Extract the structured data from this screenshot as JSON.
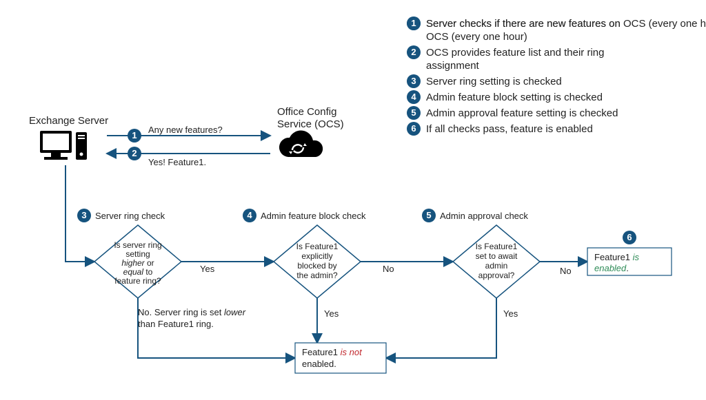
{
  "nodes": {
    "exchange": {
      "label": "Exchange Server"
    },
    "ocs": {
      "label1": "Office Config",
      "label2": "Service (OCS)"
    }
  },
  "topArrows": {
    "q": {
      "num": "1",
      "text": "Any new features?"
    },
    "a": {
      "num": "2",
      "text": "Yes! Feature1."
    }
  },
  "checks": {
    "d3": {
      "num": "3",
      "title": "Server ring check",
      "q1": "Is server ring",
      "q2": "setting",
      "q3i": "higher",
      "q3": " or",
      "q4i": "equal",
      "q4": " to",
      "q5": "feature ring?"
    },
    "d4": {
      "num": "4",
      "title": "Admin feature block check",
      "q1": "Is Feature1",
      "q2": "explicitly",
      "q3": "blocked by",
      "q4": "the admin?"
    },
    "d5": {
      "num": "5",
      "title": "Admin approval check",
      "q1": "Is Feature1",
      "q2": "set to await",
      "q3": "admin",
      "q4": "approval?"
    }
  },
  "answers": {
    "d3no1": "No. Server ring is set ",
    "d3no_i": "lower",
    "d3no2": "than Feature1 ring.",
    "yes": "Yes",
    "no": "No"
  },
  "results": {
    "notEnabled": {
      "pre": "Feature1 ",
      "em": "is not",
      "post": "enabled."
    },
    "enabled": {
      "num": "6",
      "pre": "Feature1 ",
      "em": "is",
      "post": "enabled",
      "trail": "."
    }
  },
  "legend": {
    "1": "Server checks if there are new features on OCS (every one hour)",
    "2": "OCS provides feature list and their ring assignment",
    "3": "Server ring setting is checked",
    "4": "Admin feature block setting is checked",
    "5": "Admin approval feature setting is checked",
    "6": "If all checks pass, feature is enabled"
  }
}
